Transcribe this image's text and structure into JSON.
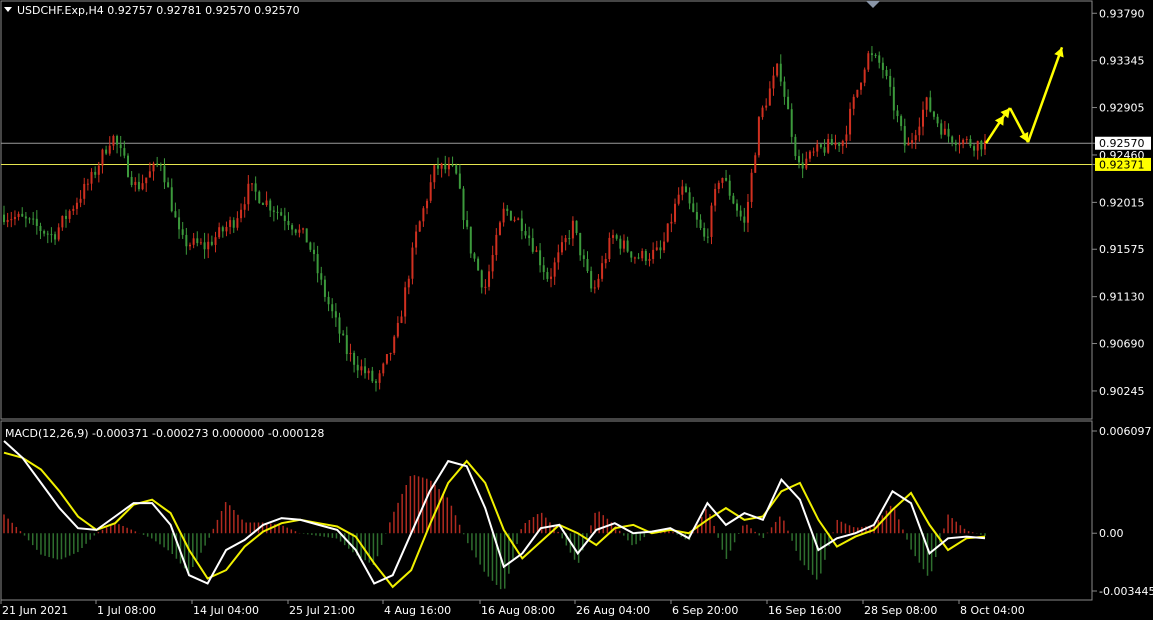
{
  "window": {
    "symbol_line": "USDCHF.Exp,H4  0.92757 0.92781 0.92570 0.92570"
  },
  "indicator": {
    "title": "MACD(12,26,9) -0.000371 -0.000273 0.000000 -0.000128"
  },
  "price_axis": {
    "ticks": [
      "0.93790",
      "0.93345",
      "0.92905",
      "0.92570",
      "0.92460",
      "0.92371",
      "0.92015",
      "0.91575",
      "0.91130",
      "0.90690",
      "0.90245"
    ]
  },
  "macd_axis": {
    "ticks": [
      "0.006097",
      "0.00",
      "-0.003445"
    ]
  },
  "time_axis": {
    "labels": [
      "21 Jun 2021",
      "1 Jul 08:00",
      "14 Jul 04:00",
      "25 Jul 21:00",
      "4 Aug 16:00",
      "16 Aug 08:00",
      "26 Aug 04:00",
      "6 Sep 20:00",
      "16 Sep 16:00",
      "28 Sep 08:00",
      "8 Oct 04:00"
    ]
  },
  "colors": {
    "background": "#000000",
    "bull_candle": "#d03020",
    "bear_candle": "#3c9a3c",
    "macd_line": "#ffffff",
    "signal_line": "#f0f000",
    "hist_positive": "#b02a20",
    "hist_negative": "#2e6e2e",
    "arrow": "#ffff00",
    "price_line": "#9a9a9a",
    "level_line": "#e6e650"
  },
  "chart_data": [
    {
      "type": "candlestick",
      "title": "USDCHF.Exp,H4",
      "ylim": [
        0.9016,
        0.9383
      ],
      "current_price": 0.9257,
      "horizontal_level": 0.92371,
      "price_path_x": [
        "21 Jun 2021",
        "1 Jul 08:00",
        "14 Jul 04:00",
        "25 Jul 21:00",
        "4 Aug 16:00",
        "16 Aug 08:00",
        "26 Aug 04:00",
        "6 Sep 20:00",
        "16 Sep 16:00",
        "28 Sep 08:00",
        "8 Oct 04:00"
      ],
      "price_path_points": [
        {
          "x": 0,
          "y": 0.919
        },
        {
          "x": 0.02,
          "y": 0.9185
        },
        {
          "x": 0.05,
          "y": 0.917
        },
        {
          "x": 0.09,
          "y": 0.9225
        },
        {
          "x": 0.11,
          "y": 0.9265
        },
        {
          "x": 0.135,
          "y": 0.9215
        },
        {
          "x": 0.16,
          "y": 0.924
        },
        {
          "x": 0.18,
          "y": 0.9165
        },
        {
          "x": 0.205,
          "y": 0.916
        },
        {
          "x": 0.235,
          "y": 0.9185
        },
        {
          "x": 0.25,
          "y": 0.9215
        },
        {
          "x": 0.29,
          "y": 0.9185
        },
        {
          "x": 0.31,
          "y": 0.9165
        },
        {
          "x": 0.325,
          "y": 0.912
        },
        {
          "x": 0.35,
          "y": 0.906
        },
        {
          "x": 0.38,
          "y": 0.903
        },
        {
          "x": 0.4,
          "y": 0.9075
        },
        {
          "x": 0.42,
          "y": 0.917
        },
        {
          "x": 0.44,
          "y": 0.9235
        },
        {
          "x": 0.46,
          "y": 0.923
        },
        {
          "x": 0.475,
          "y": 0.916
        },
        {
          "x": 0.49,
          "y": 0.912
        },
        {
          "x": 0.51,
          "y": 0.9195
        },
        {
          "x": 0.53,
          "y": 0.918
        },
        {
          "x": 0.555,
          "y": 0.913
        },
        {
          "x": 0.58,
          "y": 0.918
        },
        {
          "x": 0.6,
          "y": 0.9115
        },
        {
          "x": 0.62,
          "y": 0.917
        },
        {
          "x": 0.645,
          "y": 0.915
        },
        {
          "x": 0.67,
          "y": 0.9155
        },
        {
          "x": 0.69,
          "y": 0.9215
        },
        {
          "x": 0.715,
          "y": 0.9165
        },
        {
          "x": 0.73,
          "y": 0.923
        },
        {
          "x": 0.755,
          "y": 0.918
        },
        {
          "x": 0.77,
          "y": 0.928
        },
        {
          "x": 0.79,
          "y": 0.933
        },
        {
          "x": 0.81,
          "y": 0.9235
        },
        {
          "x": 0.83,
          "y": 0.925
        },
        {
          "x": 0.855,
          "y": 0.926
        },
        {
          "x": 0.88,
          "y": 0.934
        },
        {
          "x": 0.895,
          "y": 0.933
        },
        {
          "x": 0.92,
          "y": 0.925
        },
        {
          "x": 0.94,
          "y": 0.9295
        },
        {
          "x": 0.96,
          "y": 0.9265
        },
        {
          "x": 0.985,
          "y": 0.9257
        },
        {
          "x": 1.0,
          "y": 0.9257
        }
      ],
      "projection_arrows": [
        {
          "from": 0.9257,
          "to": 0.9283
        },
        {
          "from": 0.9283,
          "to": 0.929
        },
        {
          "from": 0.929,
          "to": 0.9258
        },
        {
          "from": 0.9258,
          "to": 0.9347
        }
      ]
    },
    {
      "type": "line",
      "title": "MACD(12,26,9)",
      "ylim": [
        -0.003445,
        0.006097
      ],
      "series": [
        {
          "name": "MACD",
          "color": "#ffffff",
          "values": [
            0.0055,
            0.0045,
            0.003,
            0.0015,
            0.0003,
            0.0002,
            0.001,
            0.0018,
            0.0018,
            0.0005,
            -0.0025,
            -0.003,
            -0.001,
            -0.0004,
            0.0005,
            0.0009,
            0.0008,
            0.0005,
            0.0002,
            -0.001,
            -0.003,
            -0.0025,
            0.0,
            0.0025,
            0.0043,
            0.004,
            0.0015,
            -0.002,
            -0.0012,
            0.0003,
            0.0005,
            -0.0012,
            0.0002,
            0.0006,
            0.0,
            0.0001,
            0.0003,
            -0.0003,
            0.0018,
            0.0005,
            0.0012,
            0.0008,
            0.0032,
            0.002,
            -0.001,
            -0.0003,
            0.0,
            0.0005,
            0.0025,
            0.0018,
            -0.0012,
            -0.0003,
            -0.0002,
            -0.0003
          ]
        },
        {
          "name": "Signal",
          "color": "#f0f000",
          "values": [
            0.0048,
            0.0045,
            0.0038,
            0.0025,
            0.001,
            0.0002,
            0.0006,
            0.0017,
            0.002,
            0.0012,
            -0.001,
            -0.0027,
            -0.0022,
            -0.0008,
            0.0001,
            0.0006,
            0.0008,
            0.0006,
            0.0004,
            -0.0002,
            -0.0018,
            -0.0032,
            -0.0022,
            0.0005,
            0.003,
            0.0043,
            0.003,
            0.0002,
            -0.0015,
            -0.0005,
            0.0005,
            0.0,
            -0.0007,
            0.0003,
            0.0005,
            0.0,
            0.0002,
            0.0,
            0.0008,
            0.0015,
            0.0008,
            0.001,
            0.0025,
            0.003,
            0.0008,
            -0.0008,
            -0.0002,
            0.0002,
            0.0014,
            0.0024,
            0.0005,
            -0.001,
            -0.0003,
            -0.0002
          ]
        }
      ]
    }
  ]
}
